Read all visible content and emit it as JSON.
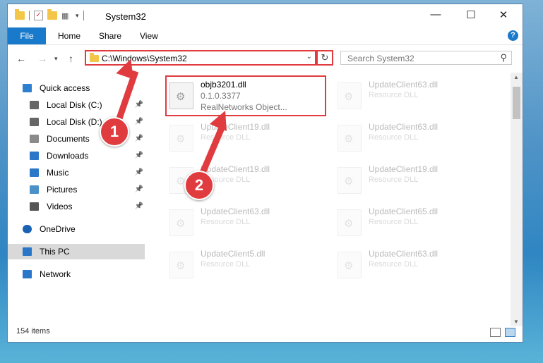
{
  "window": {
    "title": "System32"
  },
  "ribbon": {
    "file": "File",
    "tabs": [
      "Home",
      "Share",
      "View"
    ],
    "help": "?"
  },
  "address": {
    "path": "C:\\Windows\\System32"
  },
  "search": {
    "placeholder": "Search System32"
  },
  "nav": [
    {
      "label": "Quick access",
      "icon": "star-icon",
      "pinned": false
    },
    {
      "label": "Local Disk (C:)",
      "icon": "drive-icon",
      "pinned": true
    },
    {
      "label": "Local Disk (D:)",
      "icon": "drive-icon",
      "pinned": true
    },
    {
      "label": "Documents",
      "icon": "documents-icon",
      "pinned": true
    },
    {
      "label": "Downloads",
      "icon": "download-icon",
      "pinned": true
    },
    {
      "label": "Music",
      "icon": "music-icon",
      "pinned": true
    },
    {
      "label": "Pictures",
      "icon": "pictures-icon",
      "pinned": true
    },
    {
      "label": "Videos",
      "icon": "videos-icon",
      "pinned": true
    },
    {
      "label": "OneDrive",
      "icon": "cloud-icon",
      "pinned": false
    },
    {
      "label": "This PC",
      "icon": "computer-icon",
      "pinned": false,
      "selected": true
    },
    {
      "label": "Network",
      "icon": "network-icon",
      "pinned": false
    }
  ],
  "files": [
    {
      "name": "objb3201.dll",
      "line2": "0.1.0.3377",
      "line3": "RealNetworks Object...",
      "highlighted": true
    },
    {
      "name": "UpdateClient63.dll",
      "line2": "Resource DLL",
      "faded": true
    },
    {
      "name": "UpdateClient19.dll",
      "line2": "Resource DLL",
      "faded": true
    },
    {
      "name": "UpdateClient63.dll",
      "line2": "Resource DLL",
      "faded": true
    },
    {
      "name": "UpdateClient19.dll",
      "line2": "Resource DLL",
      "faded": true
    },
    {
      "name": "UpdateClient19.dll",
      "line2": "Resource DLL",
      "faded": true
    },
    {
      "name": "UpdateClient63.dll",
      "line2": "Resource DLL",
      "faded": true
    },
    {
      "name": "UpdateClient65.dll",
      "line2": "Resource DLL",
      "faded": true
    },
    {
      "name": "UpdateClient5.dll",
      "line2": "Resource DLL",
      "faded": true
    },
    {
      "name": "UpdateClient63.dll",
      "line2": "Resource DLL",
      "faded": true
    }
  ],
  "status": {
    "items": "154 items"
  },
  "annotations": [
    {
      "label": "1"
    },
    {
      "label": "2"
    }
  ],
  "colors": {
    "accent": "#1979ca",
    "annotation": "#e03b3f",
    "selected": "#d9d9d9"
  }
}
